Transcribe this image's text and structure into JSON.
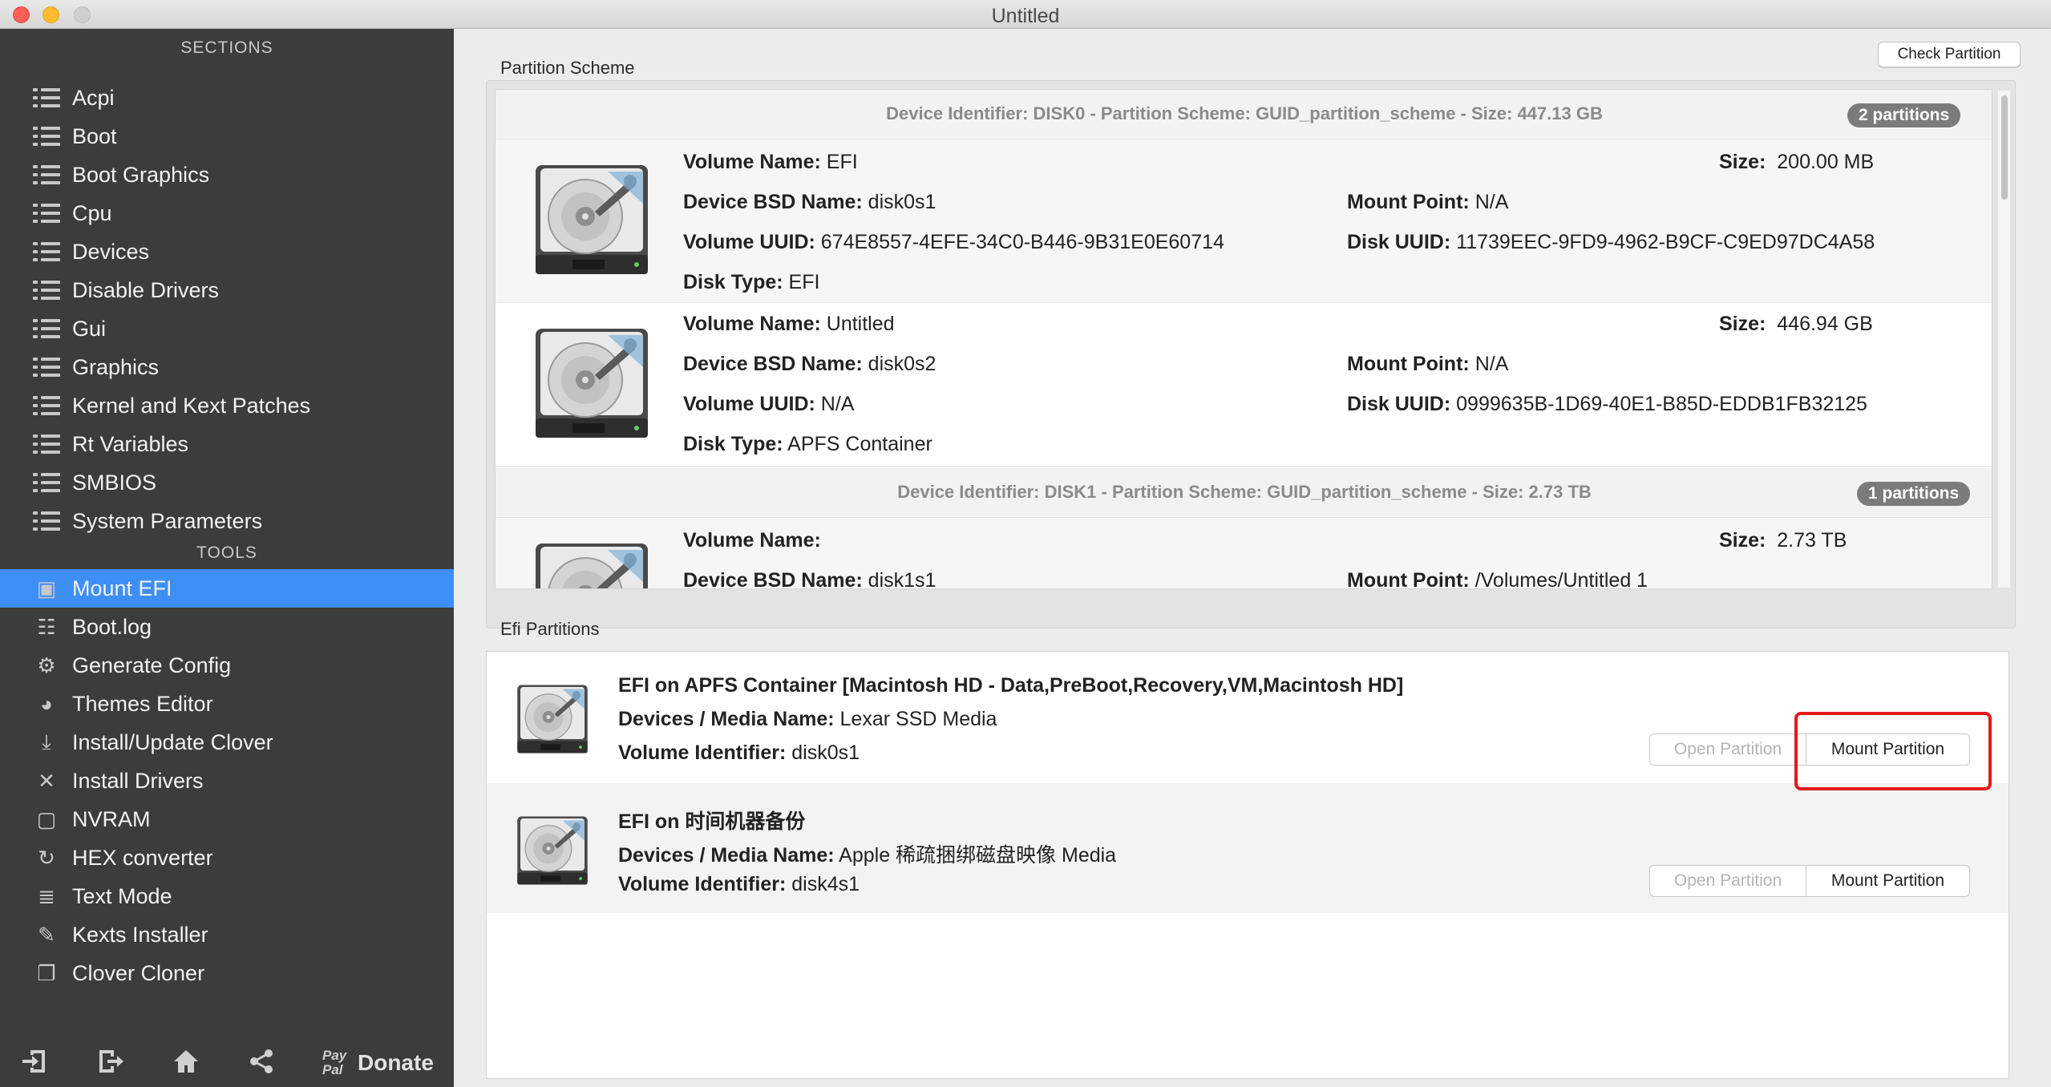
{
  "window": {
    "title": "Untitled"
  },
  "sidebar": {
    "sections_header": "SECTIONS",
    "sections": [
      {
        "label": "Acpi"
      },
      {
        "label": "Boot"
      },
      {
        "label": "Boot Graphics"
      },
      {
        "label": "Cpu"
      },
      {
        "label": "Devices"
      },
      {
        "label": "Disable Drivers"
      },
      {
        "label": "Gui"
      },
      {
        "label": "Graphics"
      },
      {
        "label": "Kernel and Kext Patches"
      },
      {
        "label": "Rt Variables"
      },
      {
        "label": "SMBIOS"
      },
      {
        "label": "System Parameters"
      }
    ],
    "tools_header": "TOOLS",
    "tools": [
      {
        "label": "Mount EFI",
        "icon": "disk-icon",
        "active": true
      },
      {
        "label": "Boot.log",
        "icon": "log-icon"
      },
      {
        "label": "Generate Config",
        "icon": "gears-icon"
      },
      {
        "label": "Themes Editor",
        "icon": "palette-icon"
      },
      {
        "label": "Install/Update Clover",
        "icon": "download-icon"
      },
      {
        "label": "Install Drivers",
        "icon": "tools-icon"
      },
      {
        "label": "NVRAM",
        "icon": "chip-icon"
      },
      {
        "label": "HEX converter",
        "icon": "refresh-icon"
      },
      {
        "label": "Text Mode",
        "icon": "text-icon"
      },
      {
        "label": "Kexts Installer",
        "icon": "plug-icon"
      },
      {
        "label": "Clover Cloner",
        "icon": "clone-icon"
      }
    ],
    "bottom": {
      "paypal_line1": "Pay",
      "paypal_line2": "Pal",
      "donate": "Donate"
    }
  },
  "partition_scheme": {
    "label": "Partition Scheme",
    "check_button": "Check Partition",
    "disks": [
      {
        "header": "Device Identifier: DISK0 - Partition Scheme: GUID_partition_scheme - Size: 447.13 GB",
        "badge": "2 partitions",
        "partitions": [
          {
            "volume_name_label": "Volume Name:",
            "volume_name": "EFI",
            "size_label": "Size:",
            "size": "200.00 MB",
            "bsd_label": "Device BSD Name:",
            "bsd": "disk0s1",
            "mount_label": "Mount Point:",
            "mount": "N/A",
            "vuuid_label": "Volume UUID:",
            "vuuid": "674E8557-4EFE-34C0-B446-9B31E0E60714",
            "duuid_label": "Disk UUID:",
            "duuid": "11739EEC-9FD9-4962-B9CF-C9ED97DC4A58",
            "type_label": "Disk Type:",
            "type": "EFI"
          },
          {
            "volume_name_label": "Volume Name:",
            "volume_name": "Untitled",
            "size_label": "Size:",
            "size": "446.94 GB",
            "bsd_label": "Device BSD Name:",
            "bsd": "disk0s2",
            "mount_label": "Mount Point:",
            "mount": "N/A",
            "vuuid_label": "Volume UUID:",
            "vuuid": "N/A",
            "duuid_label": "Disk UUID:",
            "duuid": "0999635B-1D69-40E1-B85D-EDDB1FB32125",
            "type_label": "Disk Type:",
            "type": "APFS Container"
          }
        ]
      },
      {
        "header": "Device Identifier: DISK1 - Partition Scheme: GUID_partition_scheme - Size: 2.73 TB",
        "badge": "1 partitions",
        "partitions": [
          {
            "volume_name_label": "Volume Name:",
            "volume_name": "",
            "size_label": "Size:",
            "size": "2.73 TB",
            "bsd_label": "Device BSD Name:",
            "bsd": "disk1s1",
            "mount_label": "Mount Point:",
            "mount": "/Volumes/Untitled 1"
          }
        ]
      }
    ]
  },
  "efi_partitions": {
    "label": "Efi Partitions",
    "items": [
      {
        "title": "EFI on APFS Container [Macintosh HD - Data,PreBoot,Recovery,VM,Macintosh HD]",
        "media_label": "Devices / Media Name:",
        "media": "Lexar SSD Media",
        "vid_label": "Volume Identifier:",
        "vid": "disk0s1",
        "open_button": "Open Partition",
        "mount_button": "Mount Partition"
      },
      {
        "title": "EFI on 时间机器备份",
        "media_label": "Devices / Media Name:",
        "media": "Apple 稀疏捆绑磁盘映像 Media",
        "vid_label": "Volume Identifier:",
        "vid": "disk4s1",
        "open_button": "Open Partition",
        "mount_button": "Mount Partition"
      }
    ]
  },
  "colors": {
    "sidebar_bg": "#3c3c3c",
    "accent": "#3d8ff5",
    "highlight": "#e31919"
  }
}
